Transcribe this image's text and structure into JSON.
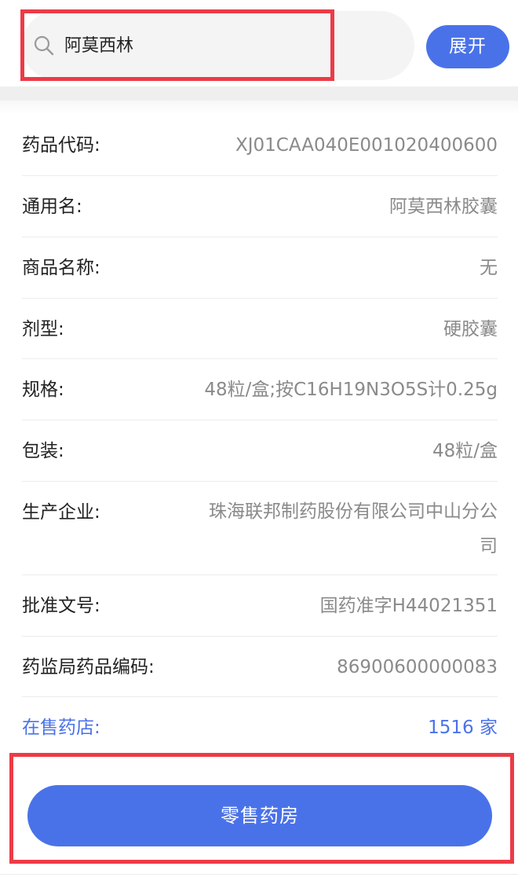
{
  "search": {
    "query": "阿莫西林",
    "icon": "search-icon"
  },
  "header": {
    "expand_label": "展开"
  },
  "details": {
    "rows": [
      {
        "label": "药品代码:",
        "value": "XJ01CAA040E001020400600"
      },
      {
        "label": "通用名:",
        "value": "阿莫西林胶囊"
      },
      {
        "label": "商品名称:",
        "value": "无"
      },
      {
        "label": "剂型:",
        "value": "硬胶囊"
      },
      {
        "label": "规格:",
        "value": "48粒/盒;按C16H19N3O5S计0.25g"
      },
      {
        "label": "包装:",
        "value": "48粒/盒"
      },
      {
        "label": "生产企业:",
        "value": "珠海联邦制药股份有限公司中山分公司"
      },
      {
        "label": "批准文号:",
        "value": "国药准字H44021351"
      },
      {
        "label": "药监局药品编码:",
        "value": "86900600000083"
      }
    ],
    "stores": {
      "label": "在售药店:",
      "value": "1516 家"
    }
  },
  "footer": {
    "retail_button_label": "零售药房"
  },
  "colors": {
    "accent": "#4a72e8",
    "highlight": "#ec3b47"
  }
}
